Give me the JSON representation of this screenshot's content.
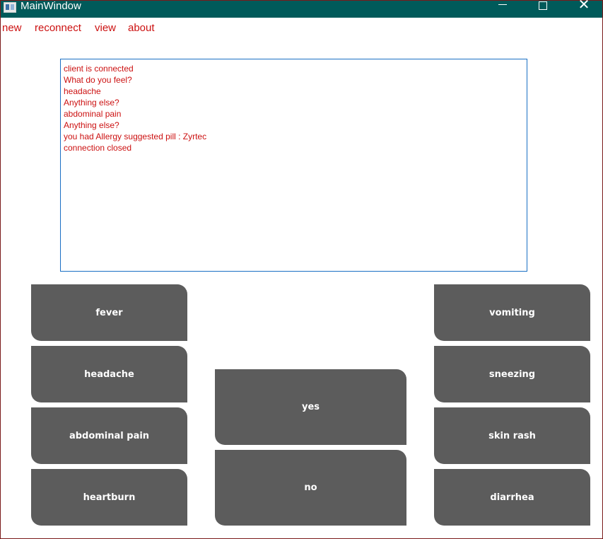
{
  "window": {
    "title": "MainWindow"
  },
  "menu": {
    "items": [
      "new",
      "reconnect",
      "view",
      "about"
    ]
  },
  "log": {
    "lines": [
      "client is connected",
      "What do you feel?",
      "headache",
      "Anything else?",
      "abdominal pain",
      "Anything else?",
      "you had Allergy suggested pill : Zyrtec",
      "connection closed"
    ]
  },
  "symptoms_left": [
    "fever",
    "headache",
    "abdominal pain",
    "heartburn"
  ],
  "symptoms_right": [
    "vomiting",
    "sneezing",
    "skin rash",
    "diarrhea"
  ],
  "answers": {
    "yes": "yes",
    "no": "no"
  },
  "colors": {
    "titlebar": "#005a5a",
    "text_accent": "#cc1111",
    "button_bg": "#5c5c5c",
    "log_border": "#1a6fc4"
  },
  "icons": {
    "app": "window-app-icon",
    "minimize": "minimize-icon",
    "maximize": "maximize-icon",
    "close": "close-icon"
  }
}
